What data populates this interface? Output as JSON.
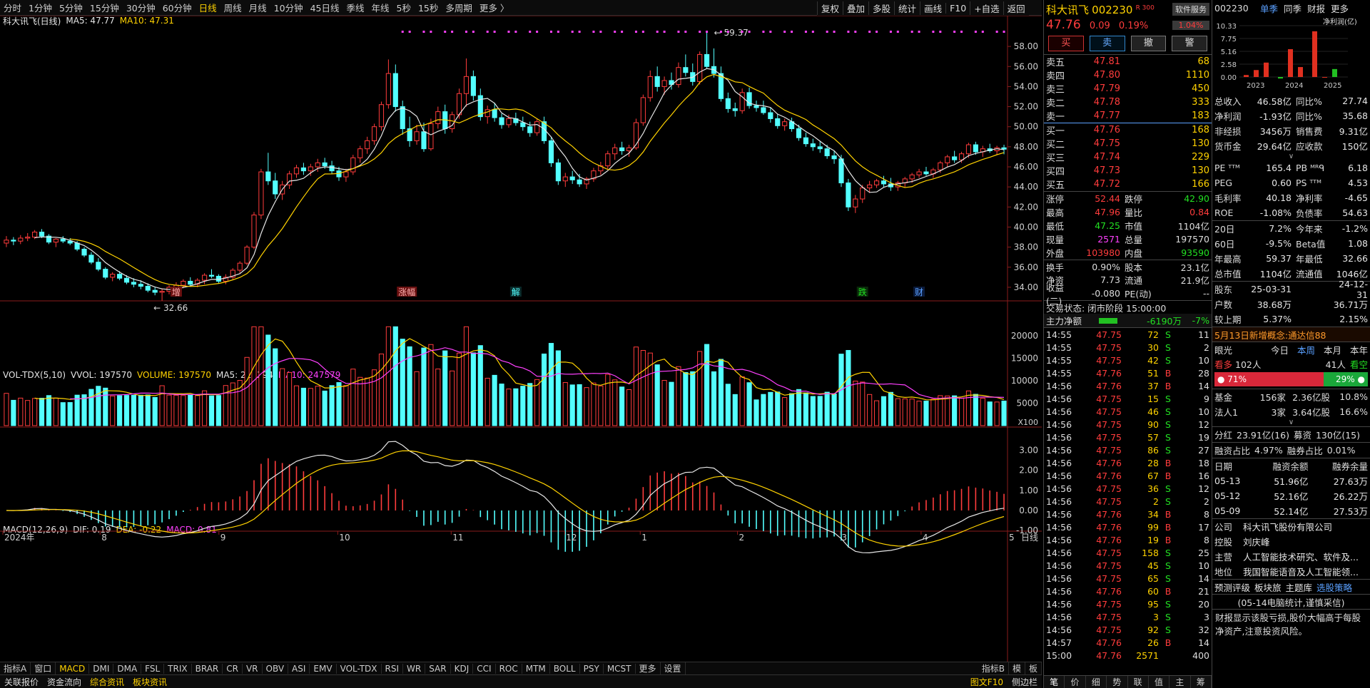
{
  "period_bar": {
    "items": [
      "分时",
      "1分钟",
      "5分钟",
      "15分钟",
      "30分钟",
      "60分钟",
      "日线",
      "周线",
      "月线",
      "10分钟",
      "45日线",
      "季线",
      "年线",
      "5秒",
      "15秒",
      "多周期",
      "更多 〉"
    ],
    "active": "日线"
  },
  "toolbar": [
    "复权",
    "叠加",
    "多股",
    "统计",
    "画线",
    "F10",
    "+自选",
    "返回"
  ],
  "legend_main": {
    "name": "科大讯飞(日线)",
    "ma5": "MA5: 47.77",
    "ma10": "MA10: 47.31"
  },
  "legend_vol": {
    "name": "VOL-TDX(5,10)",
    "vvol": "VVOL: 197570",
    "volume": "VOLUME: 197570",
    "ma5": "MA5: 216194",
    "ma10": "MA10: 247579"
  },
  "legend_macd": {
    "name": "MACD(12,26,9)",
    "dif": "DIF: 0.19",
    "dea": "DEA: -0.22",
    "macd": "MACD: 0.81"
  },
  "chart_data": {
    "type": "candlestick",
    "price_axis": [
      58,
      56,
      54,
      52,
      50,
      48,
      46,
      44,
      42,
      40,
      38,
      36,
      34
    ],
    "price_range": [
      33.0,
      59.5
    ],
    "high_label": "59.37",
    "low_label": "32.66",
    "vol_axis": [
      20000,
      15000,
      10000,
      5000
    ],
    "vol_unit": "X100",
    "macd_axis": [
      3.0,
      2.0,
      1.0,
      0.0,
      -1.0
    ],
    "month_labels": [
      "2024年",
      "8",
      "9",
      "10",
      "11",
      "12",
      "1",
      "2",
      "3",
      "4",
      "5"
    ],
    "right_label": "日线",
    "event_labels": [
      "增",
      "涨幅",
      "解",
      "跌",
      "财"
    ],
    "candles": [
      [
        38.4,
        39.1,
        38.0,
        38.7
      ],
      [
        38.7,
        39.0,
        38.2,
        38.6
      ],
      [
        38.6,
        39.2,
        38.3,
        38.9
      ],
      [
        38.9,
        39.4,
        38.6,
        39.0
      ],
      [
        39.0,
        39.7,
        38.8,
        39.5
      ],
      [
        39.5,
        39.8,
        38.9,
        39.1
      ],
      [
        39.1,
        39.3,
        38.3,
        38.5
      ],
      [
        38.5,
        38.9,
        38.0,
        38.8
      ],
      [
        38.8,
        39.1,
        38.4,
        38.6
      ],
      [
        38.6,
        38.9,
        38.2,
        38.4
      ],
      [
        38.4,
        38.6,
        37.6,
        37.8
      ],
      [
        37.8,
        38.0,
        37.0,
        37.2
      ],
      [
        37.2,
        37.5,
        36.3,
        36.5
      ],
      [
        36.5,
        36.9,
        35.6,
        35.8
      ],
      [
        35.8,
        36.0,
        34.8,
        35.0
      ],
      [
        35.0,
        35.5,
        34.6,
        35.3
      ],
      [
        35.3,
        35.6,
        34.7,
        34.9
      ],
      [
        34.9,
        35.2,
        34.3,
        34.5
      ],
      [
        34.5,
        34.9,
        34.0,
        34.3
      ],
      [
        34.3,
        34.7,
        33.8,
        34.1
      ],
      [
        34.1,
        34.4,
        33.5,
        33.7
      ],
      [
        33.7,
        34.0,
        33.2,
        33.5
      ],
      [
        33.5,
        33.9,
        32.66,
        33.6
      ],
      [
        33.6,
        34.2,
        33.3,
        34.0
      ],
      [
        34.0,
        34.5,
        33.6,
        34.2
      ],
      [
        34.2,
        34.8,
        33.9,
        34.6
      ],
      [
        34.6,
        35.0,
        34.1,
        34.3
      ],
      [
        34.3,
        34.9,
        34.0,
        34.7
      ],
      [
        34.7,
        35.4,
        34.3,
        35.2
      ],
      [
        35.2,
        35.8,
        34.9,
        35.1
      ],
      [
        35.1,
        35.3,
        34.4,
        34.6
      ],
      [
        34.6,
        35.3,
        34.3,
        35.0
      ],
      [
        35.0,
        35.9,
        34.8,
        35.7
      ],
      [
        35.7,
        36.6,
        35.4,
        36.4
      ],
      [
        36.4,
        38.2,
        36.2,
        38.0
      ],
      [
        38.0,
        41.5,
        37.8,
        41.2
      ],
      [
        41.2,
        45.8,
        40.8,
        45.5
      ],
      [
        45.5,
        47.4,
        44.2,
        44.6
      ],
      [
        44.6,
        45.4,
        42.8,
        43.3
      ],
      [
        43.3,
        44.6,
        42.7,
        44.2
      ],
      [
        44.2,
        45.6,
        43.8,
        45.3
      ],
      [
        45.3,
        46.2,
        44.9,
        45.9
      ],
      [
        45.9,
        46.4,
        45.2,
        45.6
      ],
      [
        45.6,
        46.3,
        45.1,
        46.0
      ],
      [
        46.0,
        46.8,
        45.5,
        46.4
      ],
      [
        46.4,
        46.9,
        45.8,
        46.1
      ],
      [
        46.1,
        46.6,
        45.3,
        45.6
      ],
      [
        45.6,
        46.0,
        44.6,
        45.0
      ],
      [
        45.0,
        45.8,
        44.5,
        45.5
      ],
      [
        45.5,
        47.2,
        45.2,
        46.9
      ],
      [
        46.9,
        48.1,
        46.4,
        47.8
      ],
      [
        47.8,
        49.0,
        47.3,
        48.6
      ],
      [
        48.6,
        50.3,
        48.2,
        50.0
      ],
      [
        50.0,
        52.5,
        49.6,
        52.2
      ],
      [
        52.2,
        56.7,
        51.8,
        55.3
      ],
      [
        55.3,
        56.2,
        51.5,
        52.0
      ],
      [
        52.0,
        52.6,
        49.2,
        49.8
      ],
      [
        49.8,
        51.0,
        48.0,
        48.6
      ],
      [
        48.6,
        50.2,
        48.2,
        49.5
      ],
      [
        49.5,
        50.4,
        47.5,
        47.8
      ],
      [
        47.8,
        50.8,
        47.6,
        50.3
      ],
      [
        50.3,
        52.0,
        49.8,
        51.5
      ],
      [
        51.5,
        52.2,
        49.3,
        49.8
      ],
      [
        49.8,
        51.5,
        49.4,
        51.2
      ],
      [
        51.2,
        53.8,
        50.8,
        53.3
      ],
      [
        53.3,
        56.8,
        52.0,
        55.0
      ],
      [
        55.0,
        55.6,
        52.6,
        53.1
      ],
      [
        53.1,
        53.8,
        50.6,
        51.0
      ],
      [
        51.0,
        52.1,
        50.3,
        51.7
      ],
      [
        51.7,
        52.4,
        50.5,
        50.9
      ],
      [
        50.9,
        51.3,
        49.8,
        50.2
      ],
      [
        50.2,
        51.2,
        49.9,
        50.8
      ],
      [
        50.8,
        51.4,
        50.1,
        50.4
      ],
      [
        50.4,
        51.0,
        49.6,
        50.0
      ],
      [
        50.0,
        50.5,
        49.0,
        49.4
      ],
      [
        49.4,
        50.8,
        49.1,
        50.5
      ],
      [
        50.5,
        51.0,
        48.3,
        48.6
      ],
      [
        48.6,
        49.0,
        46.0,
        46.4
      ],
      [
        46.4,
        46.8,
        44.2,
        44.6
      ],
      [
        44.6,
        45.4,
        44.0,
        45.0
      ],
      [
        45.0,
        45.6,
        44.3,
        44.7
      ],
      [
        44.7,
        45.3,
        44.0,
        44.3
      ],
      [
        44.3,
        45.0,
        43.8,
        44.8
      ],
      [
        44.8,
        45.9,
        44.5,
        45.6
      ],
      [
        45.6,
        46.5,
        45.2,
        46.1
      ],
      [
        46.1,
        47.6,
        45.8,
        47.3
      ],
      [
        47.3,
        48.3,
        46.7,
        47.9
      ],
      [
        47.9,
        48.5,
        47.2,
        47.6
      ],
      [
        47.6,
        48.2,
        47.0,
        47.9
      ],
      [
        47.9,
        50.8,
        47.7,
        50.4
      ],
      [
        50.4,
        53.2,
        50.1,
        52.9
      ],
      [
        52.9,
        55.6,
        52.5,
        55.0
      ],
      [
        55.0,
        56.0,
        53.5,
        54.0
      ],
      [
        54.0,
        55.0,
        53.2,
        54.6
      ],
      [
        54.6,
        55.4,
        53.7,
        54.2
      ],
      [
        54.2,
        56.4,
        53.9,
        55.9
      ],
      [
        55.9,
        57.2,
        55.0,
        55.4
      ],
      [
        55.4,
        56.3,
        54.1,
        54.5
      ],
      [
        54.5,
        57.5,
        54.2,
        57.2
      ],
      [
        57.2,
        59.37,
        55.8,
        56.0
      ],
      [
        56.0,
        57.8,
        54.9,
        55.3
      ],
      [
        55.3,
        56.0,
        52.5,
        52.8
      ],
      [
        52.8,
        53.4,
        51.4,
        51.8
      ],
      [
        51.8,
        52.4,
        51.0,
        51.6
      ],
      [
        51.6,
        53.8,
        51.3,
        53.4
      ],
      [
        53.4,
        53.9,
        51.8,
        52.1
      ],
      [
        52.1,
        52.6,
        51.5,
        51.9
      ],
      [
        51.9,
        52.6,
        51.2,
        51.4
      ],
      [
        51.4,
        51.9,
        50.4,
        50.8
      ],
      [
        50.8,
        51.3,
        49.8,
        50.1
      ],
      [
        50.1,
        50.8,
        49.6,
        50.5
      ],
      [
        50.5,
        50.9,
        49.5,
        49.8
      ],
      [
        49.8,
        50.2,
        48.6,
        48.9
      ],
      [
        48.9,
        49.4,
        48.0,
        48.3
      ],
      [
        48.3,
        48.8,
        47.6,
        48.0
      ],
      [
        48.0,
        48.6,
        47.4,
        47.8
      ],
      [
        47.8,
        48.2,
        46.8,
        47.1
      ],
      [
        47.1,
        47.6,
        46.3,
        46.8
      ],
      [
        46.8,
        47.2,
        44.0,
        44.4
      ],
      [
        44.4,
        44.8,
        41.6,
        42.0
      ],
      [
        42.0,
        43.2,
        41.4,
        42.8
      ],
      [
        42.8,
        44.2,
        42.4,
        43.9
      ],
      [
        43.9,
        44.6,
        43.4,
        44.2
      ],
      [
        44.2,
        44.8,
        43.9,
        44.6
      ],
      [
        44.6,
        45.1,
        44.0,
        44.3
      ],
      [
        44.3,
        44.9,
        43.6,
        44.0
      ],
      [
        44.0,
        44.6,
        43.6,
        44.4
      ],
      [
        44.4,
        45.0,
        44.0,
        44.8
      ],
      [
        44.8,
        45.4,
        44.4,
        45.2
      ],
      [
        45.2,
        45.8,
        44.9,
        45.5
      ],
      [
        45.5,
        46.0,
        45.1,
        45.3
      ],
      [
        45.3,
        45.9,
        44.9,
        45.7
      ],
      [
        45.7,
        46.6,
        45.4,
        46.4
      ],
      [
        46.4,
        47.2,
        46.0,
        47.0
      ],
      [
        47.0,
        47.6,
        46.4,
        46.7
      ],
      [
        46.7,
        47.5,
        46.4,
        47.3
      ],
      [
        47.3,
        48.4,
        46.9,
        48.2
      ],
      [
        48.2,
        48.5,
        47.2,
        47.5
      ],
      [
        47.5,
        48.1,
        47.0,
        47.8
      ],
      [
        47.8,
        48.3,
        47.4,
        47.6
      ],
      [
        47.6,
        48.1,
        47.2,
        47.9
      ],
      [
        47.9,
        48.2,
        47.25,
        47.76
      ]
    ]
  },
  "quote": {
    "name": "科大讯飞",
    "code": "002230",
    "tag": "R 300",
    "price": "47.76",
    "change": "0.09",
    "pct": "0.19%",
    "service": "软件服务",
    "service_pct": "1.04%",
    "buttons": [
      "买",
      "卖",
      "撤",
      "警"
    ],
    "asks": [
      [
        "卖五",
        "47.81",
        "68"
      ],
      [
        "卖四",
        "47.80",
        "1110"
      ],
      [
        "卖三",
        "47.79",
        "450"
      ],
      [
        "卖二",
        "47.78",
        "333"
      ],
      [
        "卖一",
        "47.77",
        "183"
      ]
    ],
    "bids": [
      [
        "买一",
        "47.76",
        "168"
      ],
      [
        "买二",
        "47.75",
        "130"
      ],
      [
        "买三",
        "47.74",
        "229"
      ],
      [
        "买四",
        "47.73",
        "130"
      ],
      [
        "买五",
        "47.72",
        "166"
      ]
    ],
    "stats": [
      [
        "涨停",
        "52.44",
        "跌停",
        "42.90"
      ],
      [
        "最高",
        "47.96",
        "量比",
        "0.84"
      ],
      [
        "最低",
        "47.25",
        "市值",
        "1104亿"
      ],
      [
        "现量",
        "2571",
        "总量",
        "197570"
      ],
      [
        "外盘",
        "103980",
        "内盘",
        "93590"
      ],
      [
        "换手",
        "0.90%",
        "股本",
        "23.1亿"
      ],
      [
        "净资",
        "7.73",
        "流通",
        "21.9亿"
      ],
      [
        "收益(二)",
        "-0.080",
        "PE(动)",
        "--"
      ]
    ],
    "trade_state": "交易状态: 闭市阶段 15:00:00",
    "main_flow_label": "主力净额",
    "main_flow": "-6190万",
    "main_flow_pct": "-7%",
    "ticks": [
      [
        "14:55",
        "47.75",
        "72",
        "S",
        "11"
      ],
      [
        "14:55",
        "47.75",
        "30",
        "S",
        "2"
      ],
      [
        "14:55",
        "47.75",
        "42",
        "S",
        "10"
      ],
      [
        "14:55",
        "47.76",
        "51",
        "B",
        "28"
      ],
      [
        "14:56",
        "47.76",
        "37",
        "B",
        "14"
      ],
      [
        "14:56",
        "47.75",
        "15",
        "S",
        "9"
      ],
      [
        "14:56",
        "47.75",
        "46",
        "S",
        "10"
      ],
      [
        "14:56",
        "47.75",
        "90",
        "S",
        "12"
      ],
      [
        "14:56",
        "47.75",
        "57",
        "S",
        "19"
      ],
      [
        "14:56",
        "47.75",
        "86",
        "S",
        "27"
      ],
      [
        "14:56",
        "47.76",
        "28",
        "B",
        "18"
      ],
      [
        "14:56",
        "47.76",
        "67",
        "B",
        "16"
      ],
      [
        "14:56",
        "47.75",
        "36",
        "S",
        "12"
      ],
      [
        "14:56",
        "47.75",
        "2",
        "S",
        "2"
      ],
      [
        "14:56",
        "47.76",
        "34",
        "B",
        "8"
      ],
      [
        "14:56",
        "47.76",
        "99",
        "B",
        "17"
      ],
      [
        "14:56",
        "47.76",
        "19",
        "B",
        "8"
      ],
      [
        "14:56",
        "47.75",
        "158",
        "S",
        "25"
      ],
      [
        "14:56",
        "47.75",
        "45",
        "S",
        "10"
      ],
      [
        "14:56",
        "47.75",
        "65",
        "S",
        "14"
      ],
      [
        "14:56",
        "47.76",
        "60",
        "B",
        "21"
      ],
      [
        "14:56",
        "47.75",
        "95",
        "S",
        "20"
      ],
      [
        "14:56",
        "47.75",
        "3",
        "S",
        "3"
      ],
      [
        "14:56",
        "47.75",
        "92",
        "S",
        "32"
      ],
      [
        "14:57",
        "47.76",
        "26",
        "B",
        "14"
      ],
      [
        "15:00",
        "47.76",
        "2571",
        "",
        "400"
      ]
    ],
    "tabs": [
      "笔",
      "价",
      "细",
      "势",
      "联",
      "值",
      "主",
      "筹"
    ]
  },
  "info": {
    "code": "002230",
    "tabs": [
      "单季",
      "同季",
      "财报",
      "更多"
    ],
    "mini_chart": {
      "title": "净利润(亿)",
      "yticks": [
        "10.33",
        "7.75",
        "5.16",
        "2.58",
        "0.00"
      ],
      "years": [
        "2023",
        "2024",
        "2025"
      ]
    },
    "rows1": [
      [
        "总收入",
        "46.58亿",
        "同比%",
        "27.74"
      ],
      [
        "净利润",
        "-1.93亿",
        "同比%",
        "35.68"
      ],
      [
        "非经损",
        "3456万",
        "销售费",
        "9.31亿"
      ],
      [
        "货币金",
        "29.64亿",
        "应收款",
        "150亿"
      ]
    ],
    "rows2": [
      [
        "PE ᵀᵀᴹ",
        "165.4",
        "PB ᴹᴿᑫ",
        "6.18"
      ],
      [
        "PEG",
        "0.60",
        "PS ᵀᵀᴹ",
        "4.53"
      ],
      [
        "毛利率",
        "40.18",
        "净利率",
        "-4.65"
      ],
      [
        "ROE",
        "-1.08%",
        "负债率",
        "54.63"
      ]
    ],
    "rows3": [
      [
        "20日",
        "7.2%",
        "今年来",
        "-1.2%"
      ],
      [
        "60日",
        "-9.5%",
        "Beta值",
        "1.08"
      ],
      [
        "年最高",
        "59.37",
        "年最低",
        "32.66"
      ],
      [
        "总市值",
        "1104亿",
        "流通值",
        "1046亿"
      ]
    ],
    "rows4": [
      [
        "股东",
        "25-03-31",
        "",
        "24-12-31"
      ],
      [
        "户数",
        "38.68万",
        "",
        "36.71万"
      ],
      [
        "较上期",
        "5.37%",
        "",
        "2.15%"
      ]
    ],
    "news": "5月13日新增概念:通达信88",
    "view_label": "眼光",
    "view_tabs": [
      "今日",
      "本周",
      "本月",
      "本年"
    ],
    "bull": "看多",
    "bull_n": "102人",
    "bear_n": "41人",
    "bear": "看空",
    "bull_pct": "71%",
    "bear_pct": "29%",
    "funds": [
      [
        "基金",
        "156家",
        "2.36亿股",
        "10.8%"
      ],
      [
        "法人1",
        "3家",
        "3.64亿股",
        "16.6%"
      ]
    ],
    "div": [
      "分红",
      "23.91亿(16)",
      "募资",
      "130亿(15)"
    ],
    "margin": [
      "融资占比",
      "4.97%",
      "融券占比",
      "0.01%"
    ],
    "margin_head": [
      "日期",
      "融资余额",
      "融券余量"
    ],
    "margin_rows": [
      [
        "05-13",
        "51.96亿",
        "27.63万"
      ],
      [
        "05-12",
        "52.16亿",
        "26.22万"
      ],
      [
        "05-09",
        "52.14亿",
        "27.53万"
      ]
    ],
    "company": [
      [
        "公司",
        "科大讯飞股份有限公司"
      ],
      [
        "控股",
        "刘庆峰"
      ],
      [
        "主营",
        "人工智能技术研究、软件及..."
      ],
      [
        "地位",
        "我国智能语音及人工智能领..."
      ]
    ],
    "links": [
      "预测评级",
      "板块旅",
      "主题库",
      "选股策略"
    ],
    "note": "(05-14电脑统计,谨慎采信)",
    "bottom": "财报显示该股亏损,股价大幅高于每股净资产,注意投资风险。"
  },
  "tabs": [
    "指标A",
    "窗口",
    "MACD",
    "DMI",
    "DMA",
    "FSL",
    "TRIX",
    "BRAR",
    "CR",
    "VR",
    "OBV",
    "ASI",
    "EMV",
    "VOL-TDX",
    "RSI",
    "WR",
    "SAR",
    "KDJ",
    "CCI",
    "ROC",
    "MTM",
    "BOLL",
    "PSY",
    "MCST",
    "更多",
    "设置"
  ],
  "tabs_right": [
    "指标B",
    "模",
    "板"
  ],
  "bottom_bar": [
    "关联报价",
    "资金流向",
    "综合资讯",
    "板块资讯"
  ],
  "bottom_right": [
    "图文F10",
    "侧边栏"
  ]
}
